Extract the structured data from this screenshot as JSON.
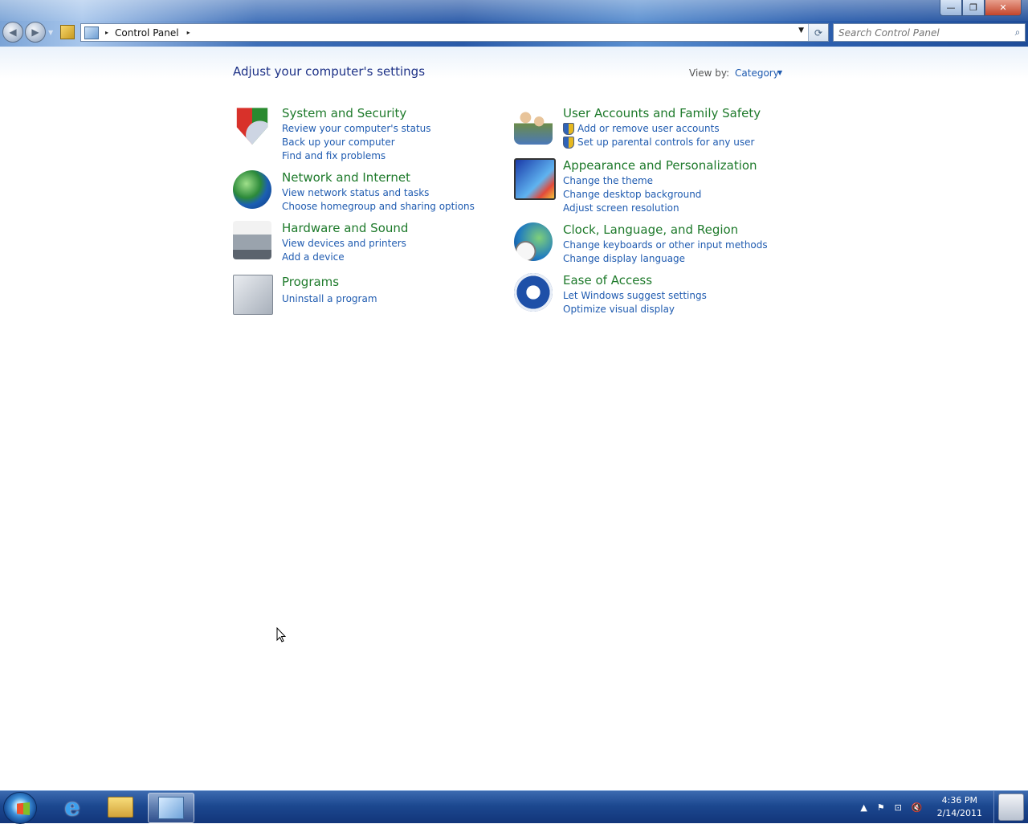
{
  "window": {
    "controls": {
      "minimize": "—",
      "maximize": "❐",
      "close": "✕"
    }
  },
  "navigation": {
    "back_icon": "◀",
    "forward_icon": "▶",
    "dropdown_icon": "▼"
  },
  "address": {
    "breadcrumb_root_arrow": "▸",
    "breadcrumb": "Control Panel",
    "breadcrumb_arrow": "▸",
    "dropdown_icon": "▼",
    "refresh_icon": "⟳"
  },
  "search": {
    "placeholder": "Search Control Panel",
    "icon": "⌕"
  },
  "main": {
    "title": "Adjust your computer's settings",
    "view_by_label": "View by:",
    "view_by_value": "Category",
    "view_by_caret": "▼",
    "categories": [
      {
        "heading": "System and Security",
        "icon": "shield-pie-icon",
        "links": [
          "Review your computer's status",
          "Back up your computer",
          "Find and fix problems"
        ]
      },
      {
        "heading": "Network and Internet",
        "icon": "network-globe-icon",
        "links": [
          "View network status and tasks",
          "Choose homegroup and sharing options"
        ]
      },
      {
        "heading": "Hardware and Sound",
        "icon": "printer-speaker-icon",
        "links": [
          "View devices and printers",
          "Add a device"
        ]
      },
      {
        "heading": "Programs",
        "icon": "programs-box-icon",
        "links": [
          "Uninstall a program"
        ]
      },
      {
        "heading": "User Accounts and Family Safety",
        "icon": "users-icon",
        "links": [
          "Add or remove user accounts",
          "Set up parental controls for any user"
        ]
      },
      {
        "heading": "Appearance and Personalization",
        "icon": "monitor-paint-icon",
        "links": [
          "Change the theme",
          "Change desktop background",
          "Adjust screen resolution"
        ]
      },
      {
        "heading": "Clock, Language, and Region",
        "icon": "clock-globe-icon",
        "links": [
          "Change keyboards or other input methods",
          "Change display language"
        ]
      },
      {
        "heading": "Ease of Access",
        "icon": "ease-of-access-icon",
        "links": [
          "Let Windows suggest settings",
          "Optimize visual display"
        ]
      }
    ]
  },
  "taskbar": {
    "ie_glyph": "e",
    "tray_chevron": "▲",
    "tray_flag": "⚑",
    "tray_network": "⊡",
    "tray_volume": "🔇",
    "time": "4:36 PM",
    "date": "2/14/2011"
  },
  "colors": {
    "heading_green": "#1e7a2b",
    "link_blue": "#1f5bb0",
    "title_blue": "#1e3287"
  }
}
